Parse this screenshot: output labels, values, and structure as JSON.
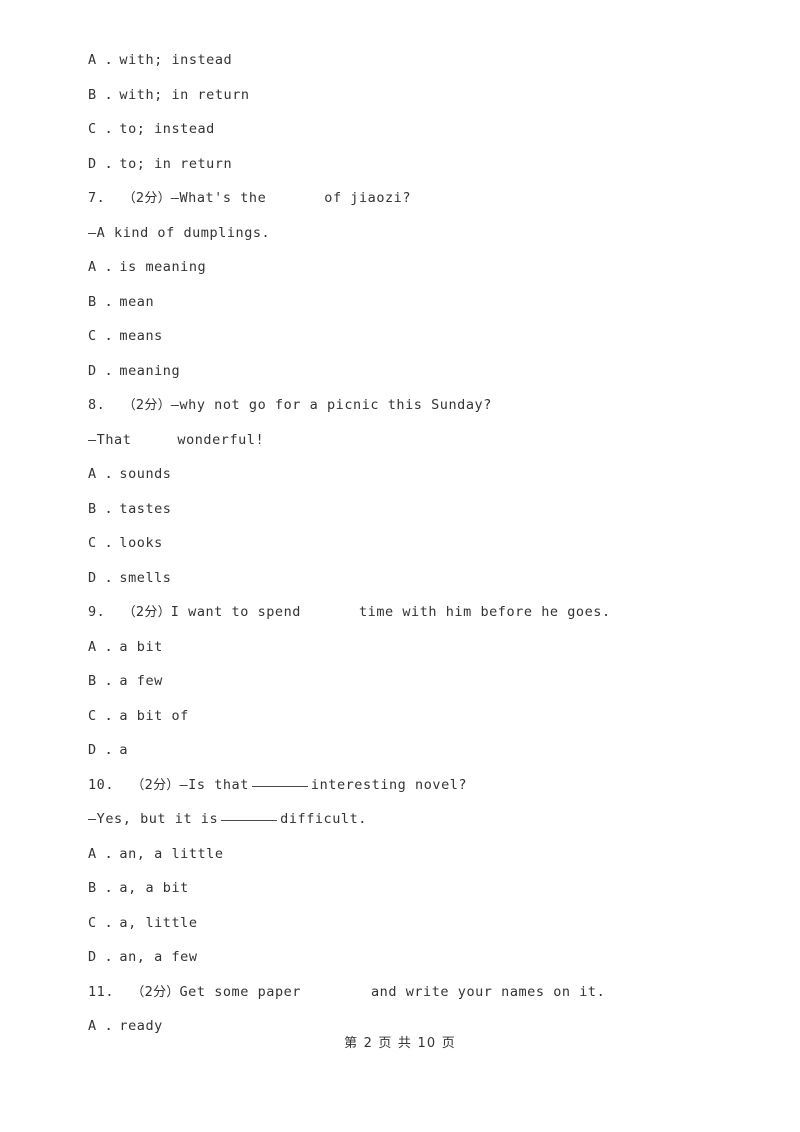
{
  "document": {
    "type": "exam-worksheet",
    "language": "en-with-zh-annotations",
    "page_background": "#ffffff",
    "text_color": "#333333"
  },
  "lines": [
    {
      "id": "q6-opt-a",
      "kind": "option",
      "text": "A ．with; instead"
    },
    {
      "id": "q6-opt-b",
      "kind": "option",
      "text": "B ．with; in return"
    },
    {
      "id": "q6-opt-c",
      "kind": "option",
      "text": "C ．to; instead"
    },
    {
      "id": "q6-opt-d",
      "kind": "option",
      "text": "D ．to; in return"
    },
    {
      "id": "q7-stem",
      "kind": "stem-blank-space",
      "number": "7.",
      "marks": "（2分）",
      "before": "—What's the",
      "after": "of jiaozi?"
    },
    {
      "id": "q7-stem-2",
      "kind": "stem",
      "text": "—A kind of dumplings."
    },
    {
      "id": "q7-opt-a",
      "kind": "option",
      "text": "A ．is meaning"
    },
    {
      "id": "q7-opt-b",
      "kind": "option",
      "text": "B ．mean"
    },
    {
      "id": "q7-opt-c",
      "kind": "option",
      "text": "C ．means"
    },
    {
      "id": "q7-opt-d",
      "kind": "option",
      "text": "D ．meaning"
    },
    {
      "id": "q8-stem",
      "kind": "stem-plain",
      "number": "8.",
      "marks": "（2分）",
      "text": "—why not go for a picnic this Sunday?"
    },
    {
      "id": "q8-stem-2",
      "kind": "stem-blank-space",
      "before": "—That",
      "after": "wonderful!"
    },
    {
      "id": "q8-opt-a",
      "kind": "option",
      "text": "A ．sounds"
    },
    {
      "id": "q8-opt-b",
      "kind": "option",
      "text": "B ．tastes"
    },
    {
      "id": "q8-opt-c",
      "kind": "option",
      "text": "C ．looks"
    },
    {
      "id": "q8-opt-d",
      "kind": "option",
      "text": "D ．smells"
    },
    {
      "id": "q9-stem",
      "kind": "stem-blank-space",
      "number": "9.",
      "marks": "（2分）",
      "before": "I want to spend",
      "after": "time with him before he goes."
    },
    {
      "id": "q9-opt-a",
      "kind": "option",
      "text": "A ．a bit"
    },
    {
      "id": "q9-opt-b",
      "kind": "option",
      "text": "B ．a few"
    },
    {
      "id": "q9-opt-c",
      "kind": "option",
      "text": "C ．a bit of"
    },
    {
      "id": "q9-opt-d",
      "kind": "option",
      "text": "D ．a"
    },
    {
      "id": "q10-stem",
      "kind": "stem-blank-rule",
      "number": "10.",
      "marks": "（2分）",
      "before": "—Is that",
      "after": "interesting novel?"
    },
    {
      "id": "q10-stem-2",
      "kind": "stem-blank-rule",
      "before": "—Yes, but it is",
      "after": "difficult."
    },
    {
      "id": "q10-opt-a",
      "kind": "option",
      "text": "A ．an, a little"
    },
    {
      "id": "q10-opt-b",
      "kind": "option",
      "text": "B ．a, a bit"
    },
    {
      "id": "q10-opt-c",
      "kind": "option",
      "text": "C ．a, little"
    },
    {
      "id": "q10-opt-d",
      "kind": "option",
      "text": "D ．an, a few"
    },
    {
      "id": "q11-stem",
      "kind": "stem-blank-space",
      "number": "11.",
      "marks": "（2分）",
      "before": "Get some paper",
      "after": "and write your names on it."
    },
    {
      "id": "q11-opt-a",
      "kind": "option",
      "text": "A ．ready"
    }
  ],
  "footer": {
    "text": "第 2 页 共 10 页",
    "current_page": "2",
    "total_pages": "10"
  }
}
